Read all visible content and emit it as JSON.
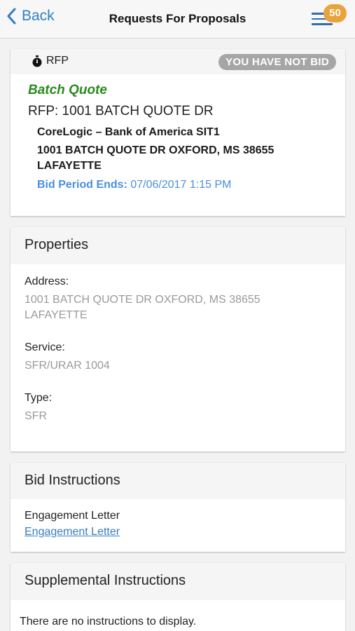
{
  "nav": {
    "back_label": "Back",
    "title": "Requests For Proposals",
    "badge_count": "50",
    "badge_color": "#e8a33a"
  },
  "rfp": {
    "label": "RFP",
    "status": "YOU HAVE NOT BID",
    "name": "Batch Quote",
    "address_title": "RFP: 1001 BATCH QUOTE DR",
    "client": "CoreLogic – Bank of America SIT1",
    "full_address": "1001 BATCH QUOTE DR OXFORD, MS 38655 LAFAYETTE",
    "bid_period_label": "Bid Period Ends:",
    "bid_period_value": "07/06/2017 1:15 PM"
  },
  "properties": {
    "title": "Properties",
    "address_label": "Address:",
    "address_value": "1001 BATCH QUOTE DR OXFORD, MS 38655 LAFAYETTE",
    "service_label": "Service:",
    "service_value": "SFR/URAR 1004",
    "type_label": "Type:",
    "type_value": "SFR"
  },
  "bid_instructions": {
    "title": "Bid Instructions",
    "engagement_label": "Engagement Letter",
    "engagement_link": "Engagement Letter"
  },
  "supplemental": {
    "title": "Supplemental Instructions",
    "empty_text": "There are no instructions to display."
  },
  "colors": {
    "accent": "#2f7fc1",
    "batch_green": "#2b8a1e",
    "link_blue": "#4a90d9",
    "pill_gray": "#a6a6a6"
  }
}
